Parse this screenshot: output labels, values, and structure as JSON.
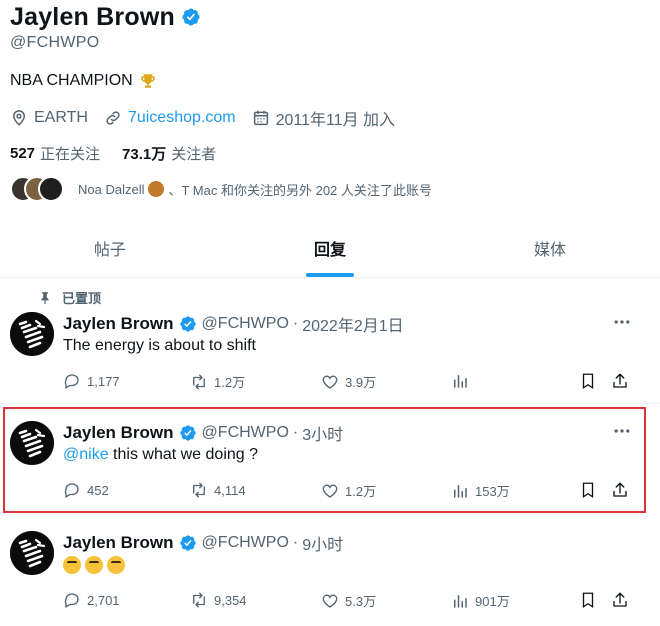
{
  "profile": {
    "name": "Jaylen Brown",
    "handle": "@FCHWPO",
    "bio": "NBA CHAMPION",
    "location": "EARTH",
    "website": "7uiceshop.com",
    "joined": "2011年11月 加入",
    "following_count": "527",
    "following_label": "正在关注",
    "followers_count": "73.1万",
    "followers_label": "关注者",
    "mutual_text_a": "Noa Dalzell",
    "mutual_text_b": "、T Mac 和你关注的另外 202 人关注了此账号"
  },
  "tabs": [
    {
      "label": "帖子",
      "active": false
    },
    {
      "label": "回复",
      "active": true
    },
    {
      "label": "媒体",
      "active": false
    }
  ],
  "tweets": [
    {
      "pinned_label": "已置顶",
      "name": "Jaylen Brown",
      "handle": "@FCHWPO",
      "dot": "·",
      "time": "2022年2月1日",
      "text": "The energy is about to shift",
      "replies": "1,177",
      "retweets": "1.2万",
      "likes": "3.9万",
      "views": ""
    },
    {
      "name": "Jaylen Brown",
      "handle": "@FCHWPO",
      "dot": "·",
      "time": "3小时",
      "mention": "@nike",
      "text": " this what we doing ?",
      "replies": "452",
      "retweets": "4,114",
      "likes": "1.2万",
      "views": "153万"
    },
    {
      "name": "Jaylen Brown",
      "handle": "@FCHWPO",
      "dot": "·",
      "time": "9小时",
      "text": "",
      "replies": "2,701",
      "retweets": "9,354",
      "likes": "5.3万",
      "views": "901万"
    }
  ],
  "colors": {
    "accent": "#1d9bf0",
    "highlight_border": "#d9343a",
    "muted": "#536471"
  },
  "icons": {
    "verified": "verified-badge-icon",
    "location": "location-pin-icon",
    "link": "link-icon",
    "calendar": "calendar-icon",
    "pin": "pin-icon",
    "more": "more-dots-icon",
    "reply": "reply-icon",
    "retweet": "retweet-icon",
    "like": "heart-icon",
    "views": "views-chart-icon",
    "bookmark": "bookmark-icon",
    "share": "share-icon"
  }
}
